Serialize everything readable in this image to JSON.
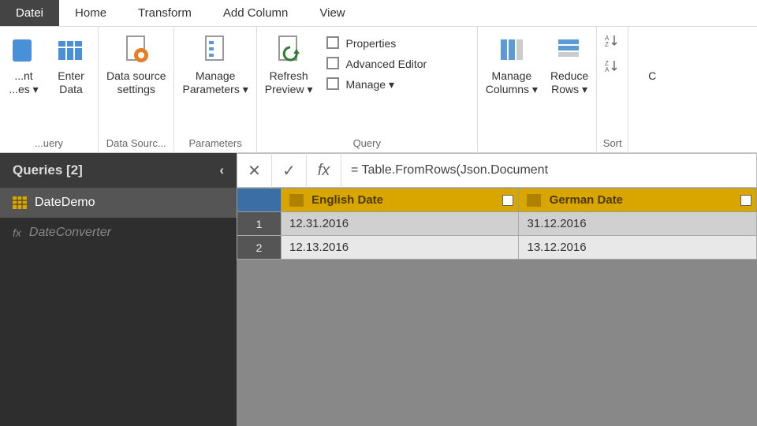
{
  "menubar": {
    "items": [
      "Datei",
      "Home",
      "Transform",
      "Add Column",
      "View"
    ],
    "active_index": 0
  },
  "ribbon": {
    "groups": [
      {
        "label": "...uery",
        "buttons": [
          {
            "label": "...nt\n...es ▾",
            "icon": "recent-sources"
          },
          {
            "label": "Enter\nData",
            "icon": "enter-data"
          }
        ]
      },
      {
        "label": "Data Sourc...",
        "buttons": [
          {
            "label": "Data source\nsettings",
            "icon": "data-source"
          }
        ]
      },
      {
        "label": "Parameters",
        "buttons": [
          {
            "label": "Manage\nParameters ▾",
            "icon": "parameters"
          }
        ]
      },
      {
        "label": "Query",
        "buttons": [
          {
            "label": "Refresh\nPreview ▾",
            "icon": "refresh"
          }
        ],
        "small_items": [
          {
            "label": "Properties",
            "icon": "properties"
          },
          {
            "label": "Advanced Editor",
            "icon": "advanced-editor"
          },
          {
            "label": "Manage ▾",
            "icon": "manage"
          }
        ]
      },
      {
        "label": "",
        "buttons": [
          {
            "label": "Manage\nColumns ▾",
            "icon": "manage-columns"
          },
          {
            "label": "Reduce\nRows ▾",
            "icon": "reduce-rows"
          }
        ]
      },
      {
        "label": "Sort",
        "buttons": [
          {
            "label": "",
            "icon": "sort-asc"
          },
          {
            "label": "",
            "icon": "sort-desc"
          }
        ]
      },
      {
        "label": "",
        "buttons": [
          {
            "label": "C",
            "icon": "split"
          }
        ]
      }
    ]
  },
  "queries": {
    "title": "Queries [2]",
    "items": [
      {
        "name": "DateDemo",
        "icon": "table",
        "selected": true
      },
      {
        "name": "DateConverter",
        "icon": "fx",
        "selected": false,
        "dim": true
      }
    ]
  },
  "formula": {
    "text": "= Table.FromRows(Json.Document"
  },
  "table": {
    "columns": [
      "English Date",
      "German Date"
    ],
    "rows": [
      [
        "12.31.2016",
        "31.12.2016"
      ],
      [
        "12.13.2016",
        "13.12.2016"
      ]
    ]
  }
}
